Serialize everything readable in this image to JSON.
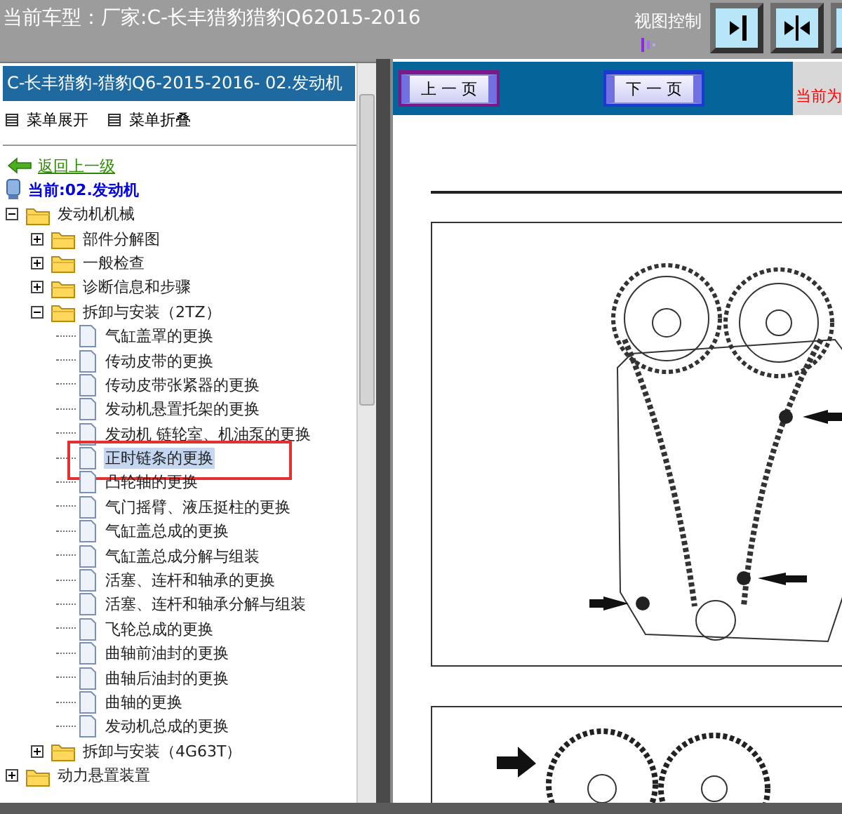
{
  "title": "当前车型：厂家:C-长丰猎豹猎豹Q62015-2016",
  "view_control": {
    "label": "视图控制"
  },
  "sidebar": {
    "header": "C-长丰猎豹-猎豹Q6-2015-2016- 02.发动机",
    "menu": [
      "菜单展开",
      "菜单折叠"
    ],
    "back_link": "返回上一级",
    "current": "当前:02.发动机",
    "tree": [
      {
        "label": "发动机机械",
        "kind": "folder",
        "expanded": true,
        "children": [
          {
            "label": "部件分解图",
            "kind": "folder",
            "expanded": false
          },
          {
            "label": "一般检查",
            "kind": "folder",
            "expanded": false
          },
          {
            "label": "诊断信息和步骤",
            "kind": "folder",
            "expanded": false
          },
          {
            "label": "拆卸与安装（2TZ）",
            "kind": "folder",
            "expanded": true,
            "children": [
              {
                "label": "气缸盖罩的更换",
                "kind": "page",
                "selected": false
              },
              {
                "label": "传动皮带的更换",
                "kind": "page",
                "selected": false
              },
              {
                "label": "传动皮带张紧器的更换",
                "kind": "page",
                "selected": false
              },
              {
                "label": "发动机悬置托架的更换",
                "kind": "page",
                "selected": false
              },
              {
                "label": "发动机  链轮室、机油泵的更换",
                "kind": "page",
                "selected": false
              },
              {
                "label": "正时链条的更换",
                "kind": "page",
                "selected": true
              },
              {
                "label": "凸轮轴的更换",
                "kind": "page",
                "selected": false
              },
              {
                "label": "气门摇臂、液压挺柱的更换",
                "kind": "page",
                "selected": false
              },
              {
                "label": "气缸盖总成的更换",
                "kind": "page",
                "selected": false
              },
              {
                "label": "气缸盖总成分解与组装",
                "kind": "page",
                "selected": false
              },
              {
                "label": "活塞、连杆和轴承的更换",
                "kind": "page",
                "selected": false
              },
              {
                "label": "活塞、连杆和轴承分解与组装",
                "kind": "page",
                "selected": false
              },
              {
                "label": "飞轮总成的更换",
                "kind": "page",
                "selected": false
              },
              {
                "label": "曲轴前油封的更换",
                "kind": "page",
                "selected": false
              },
              {
                "label": "曲轴后油封的更换",
                "kind": "page",
                "selected": false
              },
              {
                "label": "曲轴的更换",
                "kind": "page",
                "selected": false
              },
              {
                "label": "发动机总成的更换",
                "kind": "page",
                "selected": false
              }
            ]
          },
          {
            "label": "拆卸与安装（4G63T）",
            "kind": "folder",
            "expanded": false
          }
        ]
      },
      {
        "label": "动力悬置装置",
        "kind": "folder",
        "expanded": false
      }
    ]
  },
  "toolbar": {
    "prev_button": "上 一 页",
    "next_button": "下 一 页",
    "status": "当前为"
  }
}
